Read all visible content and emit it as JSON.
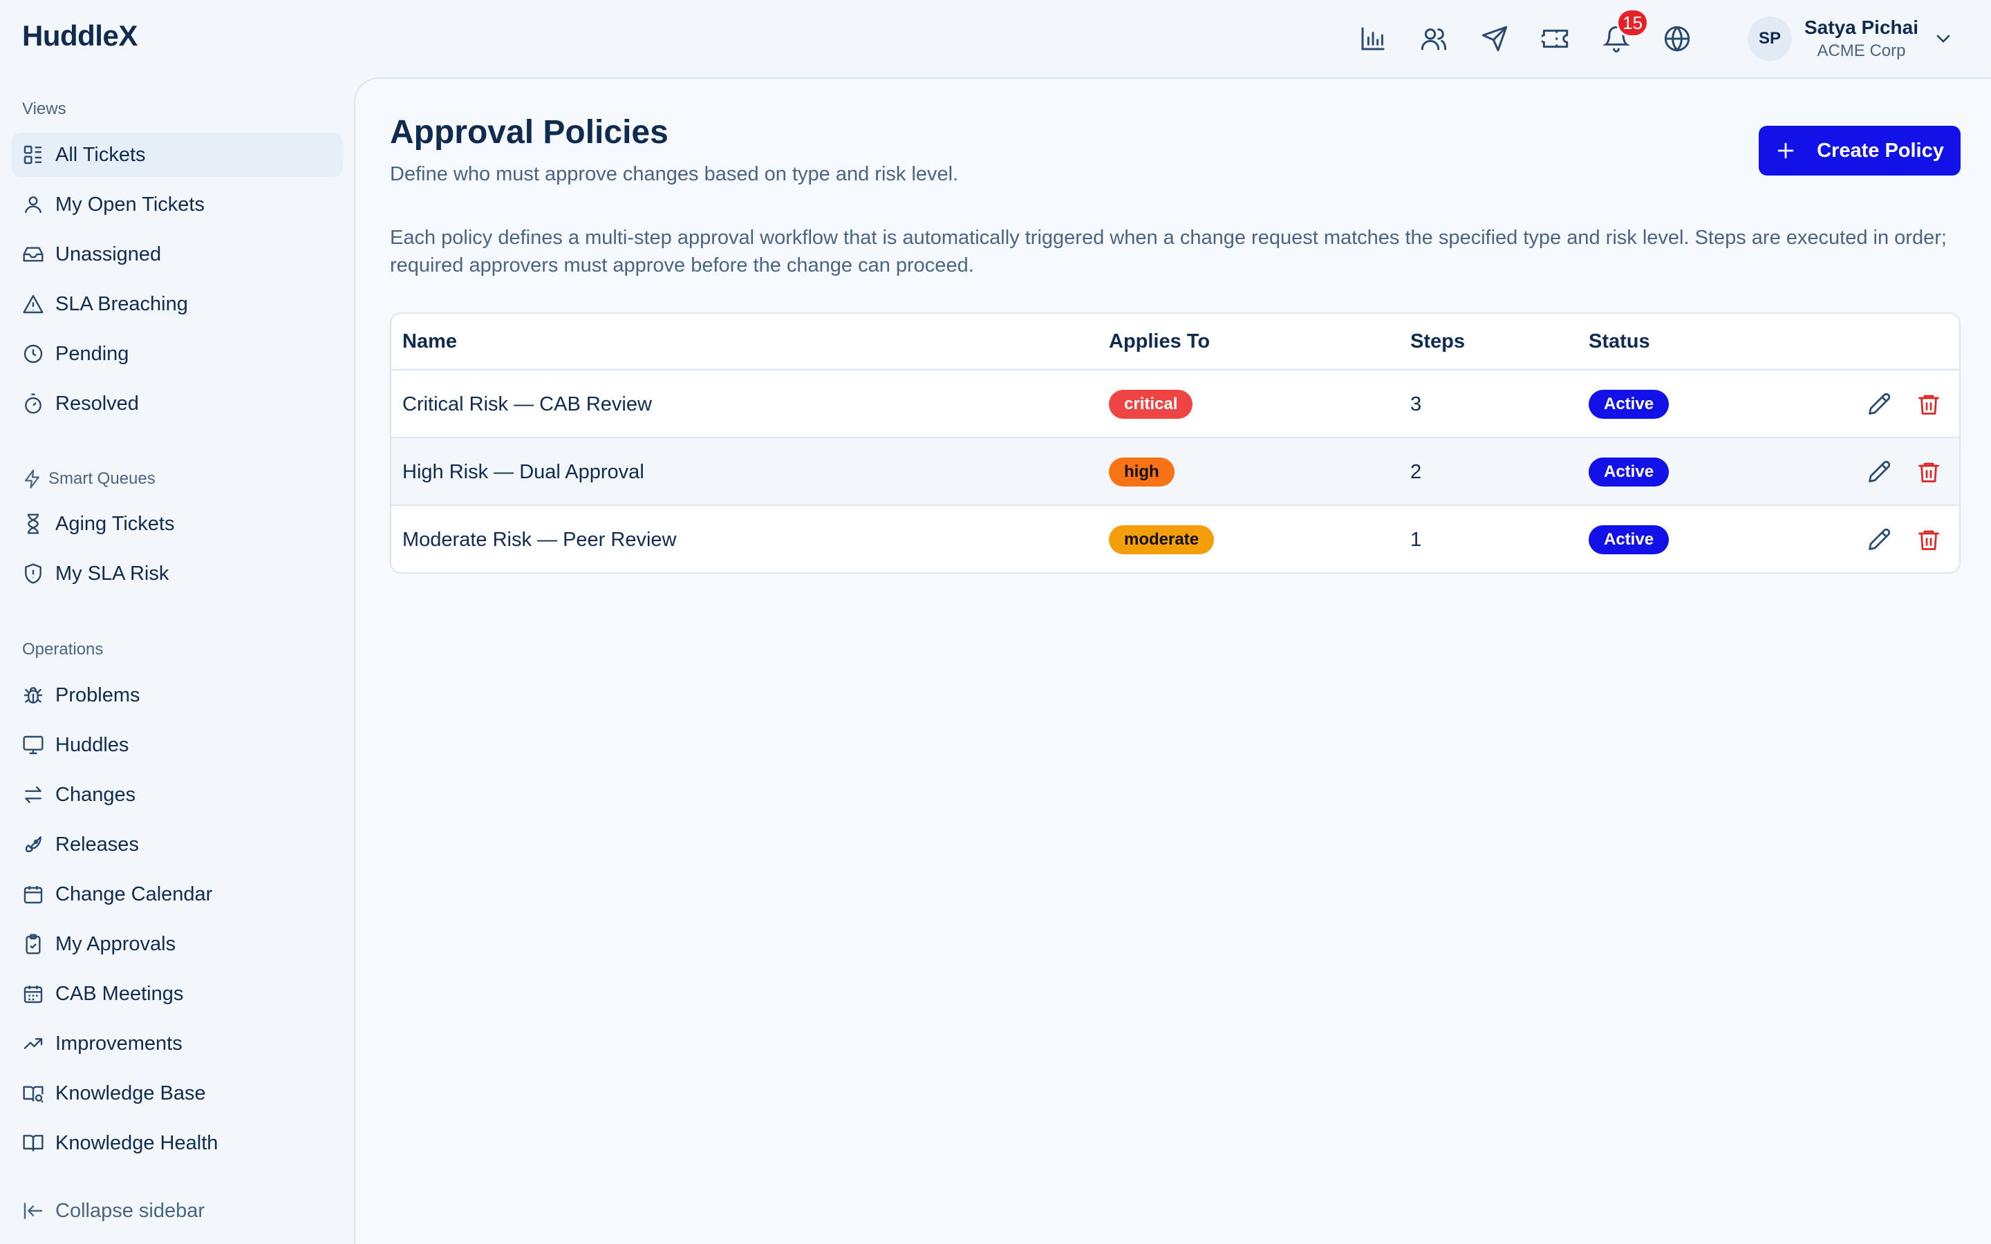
{
  "app": {
    "name": "HuddleX"
  },
  "topbar": {
    "icons": [
      "bar-chart-icon",
      "users-icon",
      "send-icon",
      "ticket-icon",
      "bell-icon",
      "globe-icon"
    ],
    "notifications_count": "15",
    "user": {
      "initials": "SP",
      "name": "Satya Pichai",
      "org": "ACME Corp"
    }
  },
  "sidebar": {
    "views_label": "Views",
    "views": [
      {
        "label": "All Tickets",
        "icon": "list-icon",
        "active": true
      },
      {
        "label": "My Open Tickets",
        "icon": "user-icon"
      },
      {
        "label": "Unassigned",
        "icon": "inbox-icon"
      },
      {
        "label": "SLA Breaching",
        "icon": "alert-triangle-icon"
      },
      {
        "label": "Pending",
        "icon": "clock-icon"
      },
      {
        "label": "Resolved",
        "icon": "timer-icon"
      }
    ],
    "smart_label": "Smart Queues",
    "smart": [
      {
        "label": "Aging Tickets",
        "icon": "hourglass-icon"
      },
      {
        "label": "My SLA Risk",
        "icon": "shield-alert-icon"
      }
    ],
    "ops_label": "Operations",
    "ops": [
      {
        "label": "Problems",
        "icon": "bug-icon"
      },
      {
        "label": "Huddles",
        "icon": "monitor-icon"
      },
      {
        "label": "Changes",
        "icon": "arrows-left-right-icon"
      },
      {
        "label": "Releases",
        "icon": "rocket-icon"
      },
      {
        "label": "Change Calendar",
        "icon": "calendar-icon"
      },
      {
        "label": "My Approvals",
        "icon": "clipboard-check-icon"
      },
      {
        "label": "CAB Meetings",
        "icon": "calendar-days-icon"
      },
      {
        "label": "Improvements",
        "icon": "trending-up-icon"
      },
      {
        "label": "Knowledge Base",
        "icon": "book-search-icon"
      },
      {
        "label": "Knowledge Health",
        "icon": "book-open-icon"
      }
    ],
    "collapse_label": "Collapse sidebar"
  },
  "main": {
    "title": "Approval Policies",
    "subtitle": "Define who must approve changes based on type and risk level.",
    "create_label": "Create Policy",
    "description": "Each policy defines a multi-step approval workflow that is automatically triggered when a change request matches the specified type and risk level. Steps are executed in order; required approvers must approve before the change can proceed.",
    "table": {
      "headers": {
        "name": "Name",
        "applies": "Applies To",
        "steps": "Steps",
        "status": "Status"
      },
      "rows": [
        {
          "name": "Critical Risk — CAB Review",
          "applies": "critical",
          "steps": "3",
          "status": "Active"
        },
        {
          "name": "High Risk — Dual Approval",
          "applies": "high",
          "steps": "2",
          "status": "Active"
        },
        {
          "name": "Moderate Risk — Peer Review",
          "applies": "moderate",
          "steps": "1",
          "status": "Active"
        }
      ]
    }
  },
  "colors": {
    "primary": "#1212e8",
    "critical": "#ef4444",
    "high": "#f97316",
    "moderate": "#f59e0b",
    "danger": "#dc2626",
    "badge": "#e5222a"
  }
}
